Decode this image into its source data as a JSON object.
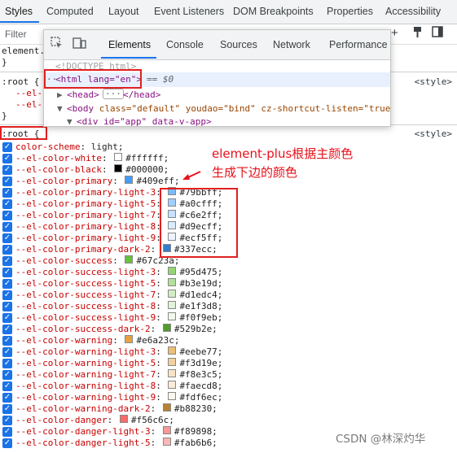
{
  "tabs": [
    "Styles",
    "Computed",
    "Layout",
    "Event Listeners",
    "DOM Breakpoints",
    "Properties",
    "Accessibility"
  ],
  "filter_placeholder": "Filter",
  "rules_top": {
    "line1": "element.",
    "line2": "}",
    "root1": ":root {",
    "decl_a": "--el-",
    "decl_b": "--el-",
    "close": "}",
    "source": "<style>"
  },
  "popup": {
    "tabs": [
      "Elements",
      "Console",
      "Sources",
      "Network",
      "Performance"
    ],
    "doctype": "<!DOCTYPE html>",
    "html_line": "<html lang=\"en\">",
    "html_suffix": "== $0",
    "head_line": "<head>",
    "head_close": "</head>",
    "ellipsis": "···",
    "body_tag": "<body",
    "body_attrs": " class=\"default\" youdao=\"bind\" cz-shortcut-listen=\"true\"",
    "div_line": "<div id=\"app\" data-v-app>"
  },
  "root_rule": {
    "selector": ":root {",
    "source": "<style>",
    "declarations": [
      {
        "name": "color-scheme",
        "value": "light;"
      },
      {
        "name": "--el-color-white",
        "value": "#ffffff;",
        "color": "#ffffff"
      },
      {
        "name": "--el-color-black",
        "value": "#000000;",
        "color": "#000000"
      },
      {
        "name": "--el-color-primary",
        "value": "#409eff;",
        "color": "#409eff"
      },
      {
        "name": "--el-color-primary-light-3",
        "value": "#79bbff;",
        "color": "#79bbff"
      },
      {
        "name": "--el-color-primary-light-5",
        "value": "#a0cfff;",
        "color": "#a0cfff"
      },
      {
        "name": "--el-color-primary-light-7",
        "value": "#c6e2ff;",
        "color": "#c6e2ff"
      },
      {
        "name": "--el-color-primary-light-8",
        "value": "#d9ecff;",
        "color": "#d9ecff"
      },
      {
        "name": "--el-color-primary-light-9",
        "value": "#ecf5ff;",
        "color": "#ecf5ff"
      },
      {
        "name": "--el-color-primary-dark-2",
        "value": "#337ecc;",
        "color": "#337ecc"
      },
      {
        "name": "--el-color-success",
        "value": "#67c23a;",
        "color": "#67c23a"
      },
      {
        "name": "--el-color-success-light-3",
        "value": "#95d475;",
        "color": "#95d475"
      },
      {
        "name": "--el-color-success-light-5",
        "value": "#b3e19d;",
        "color": "#b3e19d"
      },
      {
        "name": "--el-color-success-light-7",
        "value": "#d1edc4;",
        "color": "#d1edc4"
      },
      {
        "name": "--el-color-success-light-8",
        "value": "#e1f3d8;",
        "color": "#e1f3d8"
      },
      {
        "name": "--el-color-success-light-9",
        "value": "#f0f9eb;",
        "color": "#f0f9eb"
      },
      {
        "name": "--el-color-success-dark-2",
        "value": "#529b2e;",
        "color": "#529b2e"
      },
      {
        "name": "--el-color-warning",
        "value": "#e6a23c;",
        "color": "#e6a23c"
      },
      {
        "name": "--el-color-warning-light-3",
        "value": "#eebe77;",
        "color": "#eebe77"
      },
      {
        "name": "--el-color-warning-light-5",
        "value": "#f3d19e;",
        "color": "#f3d19e"
      },
      {
        "name": "--el-color-warning-light-7",
        "value": "#f8e3c5;",
        "color": "#f8e3c5"
      },
      {
        "name": "--el-color-warning-light-8",
        "value": "#faecd8;",
        "color": "#faecd8"
      },
      {
        "name": "--el-color-warning-light-9",
        "value": "#fdf6ec;",
        "color": "#fdf6ec"
      },
      {
        "name": "--el-color-warning-dark-2",
        "value": "#b88230;",
        "color": "#b88230"
      },
      {
        "name": "--el-color-danger",
        "value": "#f56c6c;",
        "color": "#f56c6c"
      },
      {
        "name": "--el-color-danger-light-3",
        "value": "#f89898;",
        "color": "#f89898"
      },
      {
        "name": "--el-color-danger-light-5",
        "value": "#fab6b6;",
        "color": "#fab6b6"
      }
    ]
  },
  "annotation": {
    "line1": "element-plus根据主颜色",
    "line2": "生成下边的颜色"
  },
  "watermark": "CSDN @林深灼华",
  "accent_color": "#1a73e8",
  "annotation_color": "#e8101a"
}
